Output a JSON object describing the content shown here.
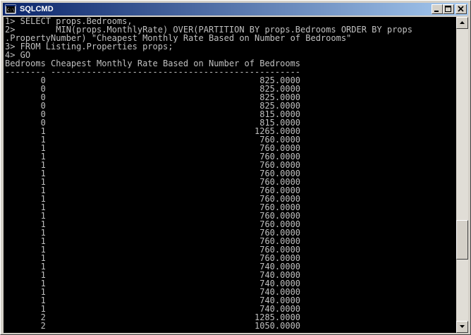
{
  "window": {
    "title": "SQLCMD",
    "icon": "console-icon",
    "buttons": [
      "minimize-icon",
      "maximize-icon",
      "close-icon"
    ]
  },
  "console": {
    "foreground": "#c0c0c0",
    "background": "#000000",
    "lines": [
      "1> SELECT props.Bedrooms,",
      "2>        MIN(props.MonthlyRate) OVER(PARTITION BY props.Bedrooms ORDER BY props",
      ".PropertyNumber) \"Cheapest Monthly Rate Based on Number of Bedrooms\"",
      "3> FROM Listing.Properties props;",
      "4> GO",
      "Bedrooms Cheapest Monthly Rate Based on Number of Bedrooms",
      "-------- -------------------------------------------------",
      "       0                                          825.0000",
      "       0                                          825.0000",
      "       0                                          825.0000",
      "       0                                          825.0000",
      "       0                                          815.0000",
      "       0                                          815.0000",
      "       1                                         1265.0000",
      "       1                                          760.0000",
      "       1                                          760.0000",
      "       1                                          760.0000",
      "       1                                          760.0000",
      "       1                                          760.0000",
      "       1                                          760.0000",
      "       1                                          760.0000",
      "       1                                          760.0000",
      "       1                                          760.0000",
      "       1                                          760.0000",
      "       1                                          760.0000",
      "       1                                          760.0000",
      "       1                                          760.0000",
      "       1                                          760.0000",
      "       1                                          760.0000",
      "       1                                          740.0000",
      "       1                                          740.0000",
      "       1                                          740.0000",
      "       1                                          740.0000",
      "       1                                          740.0000",
      "       1                                          740.0000",
      "       2                                         1285.0000",
      "       2                                         1050.0000"
    ]
  },
  "scrollbar": {
    "up_icon": "arrow-up-icon",
    "down_icon": "arrow-down-icon",
    "position": 0.7
  }
}
